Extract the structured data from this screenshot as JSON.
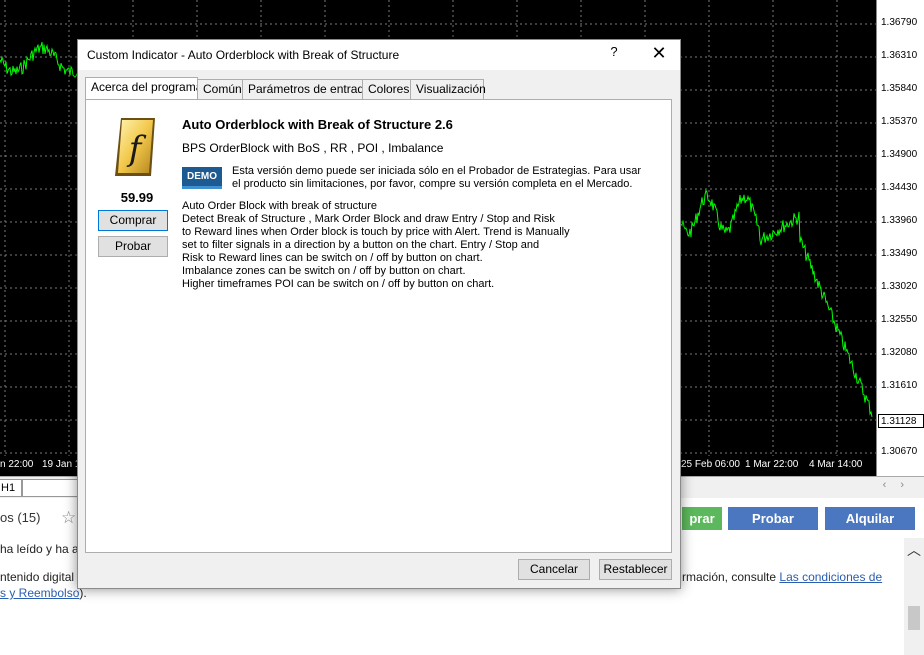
{
  "chart": {
    "price_ticks": [
      "1.36790",
      "1.36310",
      "1.35840",
      "1.35370",
      "1.34900",
      "1.34430",
      "1.33960",
      "1.33490",
      "1.33020",
      "1.32550",
      "1.32080",
      "1.31610",
      "1.31128",
      "1.30670"
    ],
    "current_price": "1.31128",
    "time_ticks": [
      "n 22:00",
      "19 Jan 1",
      "25 Feb 06:00",
      "1 Mar 22:00",
      "4 Mar 14:00"
    ],
    "line_color": "#00ff00",
    "grid_color": "#7a7a7a",
    "background": "#000000"
  },
  "chart_tabs": {
    "active_tab": "H1"
  },
  "market": {
    "reviews_label": "os (15)",
    "star_icon": "star-outline-icon",
    "buy_label": "prar",
    "try_label": "Probar",
    "rent_label": "Alquilar",
    "line1": "ha leído y ha a",
    "line2_left": "ntenido digital",
    "line2_right": "rmación, consulte ",
    "line2_link": "Las condiciones de",
    "line3_link": "s y Reembolso",
    "line3_end": ")."
  },
  "dialog": {
    "title": "Custom Indicator - Auto Orderblock with Break of Structure",
    "help_label": "?",
    "close_label": "✕",
    "tabs": [
      "Acerca del programa",
      "Común",
      "Parámetros de entrada",
      "Colores",
      "Visualización"
    ],
    "active_tab": "Acerca del programa",
    "product": {
      "logo_glyph": "f",
      "logo_icon": "mql5-product-logo-icon",
      "price": "59.99",
      "buy_button": "Comprar",
      "try_button": "Probar",
      "name": "Auto Orderblock with Break of Structure 2.6",
      "subtitle": "BPS OrderBlock with BoS , RR , POI , Imbalance",
      "demo_badge": "DEMO",
      "demo_notice": "Esta versión demo puede ser iniciada sólo en el Probador de Estrategias. Para usar el producto sin limitaciones, por favor, compre su versión completa en el Mercado.",
      "description_lines": [
        "Auto Order Block with break of structure",
        "Detect Break of Structure , Mark Order Block and draw Entry / Stop and Risk",
        "to Reward lines when Order block is touch by price with Alert. Trend is Manually",
        "set to filter signals in a direction by a button on the chart. Entry / Stop and",
        "Risk to Reward lines can be switch on / off by button on chart.",
        "Imbalance zones can be switch on / off by button on chart.",
        "Higher timeframes POI can be switch on / off by button on chart."
      ]
    },
    "cancel_button": "Cancelar",
    "reset_button": "Restablecer"
  }
}
